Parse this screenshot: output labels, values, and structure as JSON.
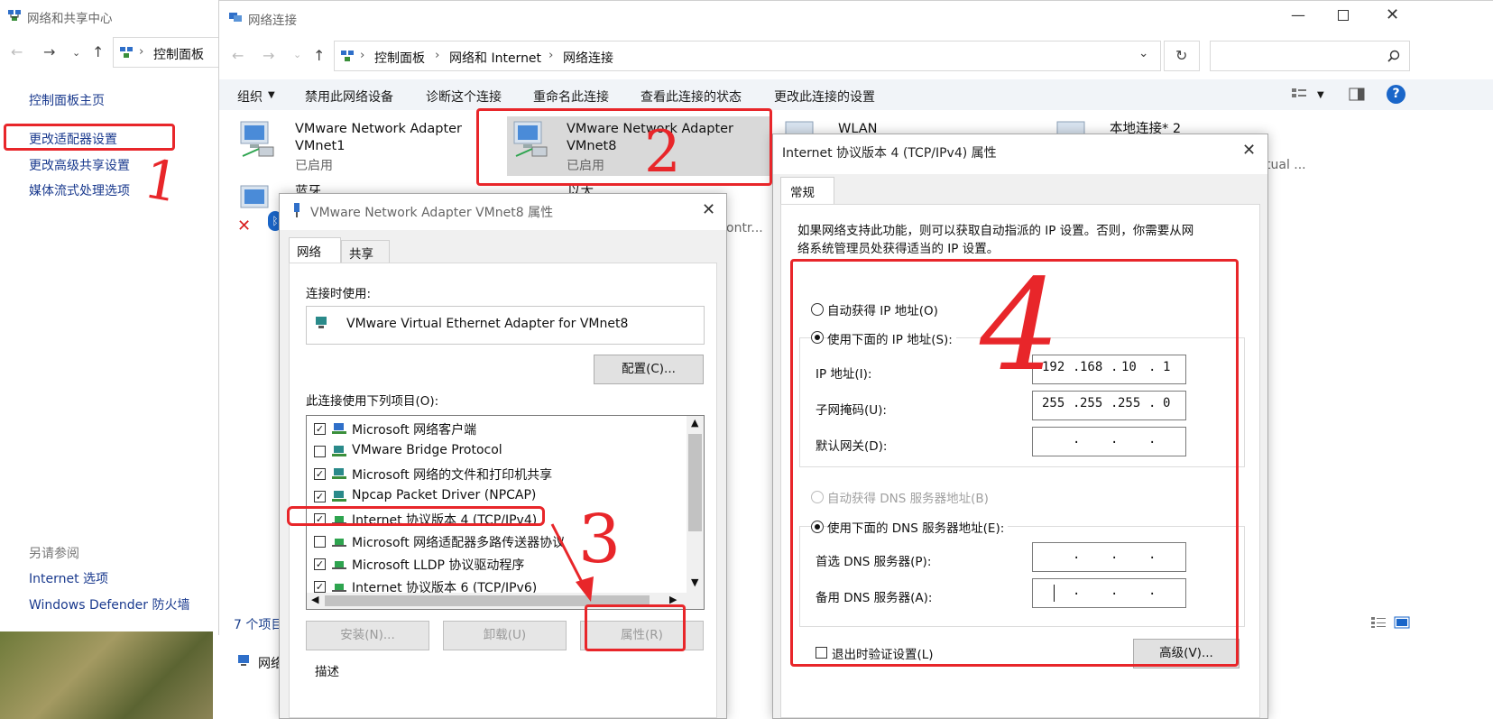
{
  "back_window": {
    "title": "网络和共享中心",
    "breadcrumb_root": "控制面板",
    "sidebar": {
      "home": "控制面板主页",
      "items": [
        "更改适配器设置",
        "更改高级共享设置",
        "媒体流式处理选项"
      ],
      "see_also_heading": "另请参阅",
      "see_also": [
        "Internet 选项",
        "Windows Defender 防火墙"
      ]
    },
    "bottom_item": "网络"
  },
  "main_window": {
    "title": "网络连接",
    "breadcrumb": [
      "控制面板",
      "网络和 Internet",
      "网络连接"
    ],
    "search_placeholder": "",
    "commands": [
      "组织",
      "禁用此网络设备",
      "诊断这个连接",
      "重命名此连接",
      "查看此连接的状态",
      "更改此连接的设置"
    ],
    "adapters": [
      {
        "name_line1": "VMware Network Adapter",
        "name_line2": "VMnet1",
        "status": "已启用"
      },
      {
        "name_line1": "VMware Network Adapter",
        "name_line2": "VMnet8",
        "status": "已启用"
      },
      {
        "name_line1": "WLAN",
        "name_line2": "",
        "status": ""
      },
      {
        "name_line1": "本地连接* 2",
        "name_line2": "",
        "status": ""
      },
      {
        "name_line1": "蓝牙网络连接",
        "name_line2": "",
        "status": ""
      },
      {
        "name_line1": "以太网",
        "name_line2": "",
        "status": ""
      }
    ],
    "partial_text_right": "tual ...",
    "partial_text_mid": "ontr...",
    "item_count": "7 个项目"
  },
  "vmnet8_dialog": {
    "title": "VMware Network Adapter VMnet8 属性",
    "tabs": [
      "网络",
      "共享"
    ],
    "connect_using_label": "连接时使用:",
    "adapter_name": "VMware Virtual Ethernet Adapter for VMnet8",
    "configure_button": "配置(C)...",
    "items_label": "此连接使用下列项目(O):",
    "items": [
      {
        "checked": true,
        "label": "Microsoft 网络客户端"
      },
      {
        "checked": false,
        "label": "VMware Bridge Protocol"
      },
      {
        "checked": true,
        "label": "Microsoft 网络的文件和打印机共享"
      },
      {
        "checked": true,
        "label": "Npcap Packet Driver (NPCAP)"
      },
      {
        "checked": true,
        "label": "Internet 协议版本 4 (TCP/IPv4)"
      },
      {
        "checked": false,
        "label": "Microsoft 网络适配器多路传送器协议"
      },
      {
        "checked": true,
        "label": "Microsoft LLDP 协议驱动程序"
      },
      {
        "checked": true,
        "label": "Internet 协议版本 6 (TCP/IPv6)"
      }
    ],
    "install_button": "安装(N)...",
    "uninstall_button": "卸载(U)",
    "properties_button": "属性(R)",
    "description_label": "描述"
  },
  "ipv4_dialog": {
    "title": "Internet 协议版本 4 (TCP/IPv4) 属性",
    "tab": "常规",
    "intro_line1": "如果网络支持此功能，则可以获取自动指派的 IP 设置。否则，你需要从网",
    "intro_line2": "络系统管理员处获得适当的 IP 设置。",
    "auto_ip": "自动获得 IP 地址(O)",
    "manual_ip": "使用下面的 IP 地址(S):",
    "ip_label": "IP 地址(I):",
    "ip_octets": [
      "192",
      "168",
      "10",
      "1"
    ],
    "mask_label": "子网掩码(U):",
    "mask_octets": [
      "255",
      "255",
      "255",
      "0"
    ],
    "gateway_label": "默认网关(D):",
    "auto_dns": "自动获得 DNS 服务器地址(B)",
    "manual_dns": "使用下面的 DNS 服务器地址(E):",
    "preferred_dns_label": "首选 DNS 服务器(P):",
    "alternate_dns_label": "备用 DNS 服务器(A):",
    "validate_label": "退出时验证设置(L)",
    "advanced_button": "高级(V)..."
  },
  "annotations": [
    "1",
    "2",
    "3",
    "4"
  ],
  "colors": {
    "annotation": "#e8262a",
    "selected_adapter": "#cce4f7",
    "command_bar": "#f1f4f8"
  }
}
